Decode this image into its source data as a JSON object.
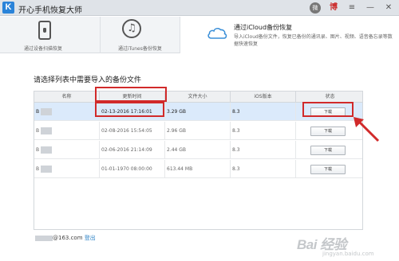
{
  "app": {
    "title": "开心手机恢复大师",
    "logo_letter": "K"
  },
  "title_controls": {
    "wechat": "微",
    "weibo": "博",
    "menu": "≡",
    "minimize": "—",
    "close": "✕"
  },
  "tabs": [
    {
      "label": "通过设备扫描恢复",
      "icon": "phone-icon"
    },
    {
      "label": "通过iTunes备份恢复",
      "icon": "music-note-icon"
    },
    {
      "title": "通过iCloud备份恢复",
      "desc": "导入iCloud备份文件，恢复已备份的通讯录、图片、视频、语音备忘录等数据快速恢复",
      "icon": "cloud-icon",
      "active": true
    }
  ],
  "section_title": "请选择列表中需要导入的备份文件",
  "table": {
    "headers": [
      "名称",
      "更新时间",
      "文件大小",
      "iOS版本",
      "状态"
    ],
    "rows": [
      {
        "name": "B",
        "time": "02-13-2016 17:16:01",
        "size": "3.29 GB",
        "ios": "8.3",
        "action": "下载",
        "selected": true
      },
      {
        "name": "B",
        "time": "02-08-2016 15:54:05",
        "size": "2.96 GB",
        "ios": "8.3",
        "action": "下载"
      },
      {
        "name": "B",
        "time": "02-06-2016 21:14:09",
        "size": "2.44 GB",
        "ios": "8.3",
        "action": "下载"
      },
      {
        "name": "B",
        "time": "01-01-1970 08:00:00",
        "size": "613.44 MB",
        "ios": "8.3",
        "action": "下载"
      }
    ]
  },
  "footer": {
    "account_suffix": "@163.com",
    "logout": "登出"
  },
  "watermark": {
    "main": "Bai 经验",
    "sub": "jingyan.baidu.com"
  },
  "colors": {
    "accent": "#2a83d9",
    "highlight": "#d12a2a",
    "selected_row": "#dbeafb",
    "titlebar": "#dfe3e8"
  }
}
